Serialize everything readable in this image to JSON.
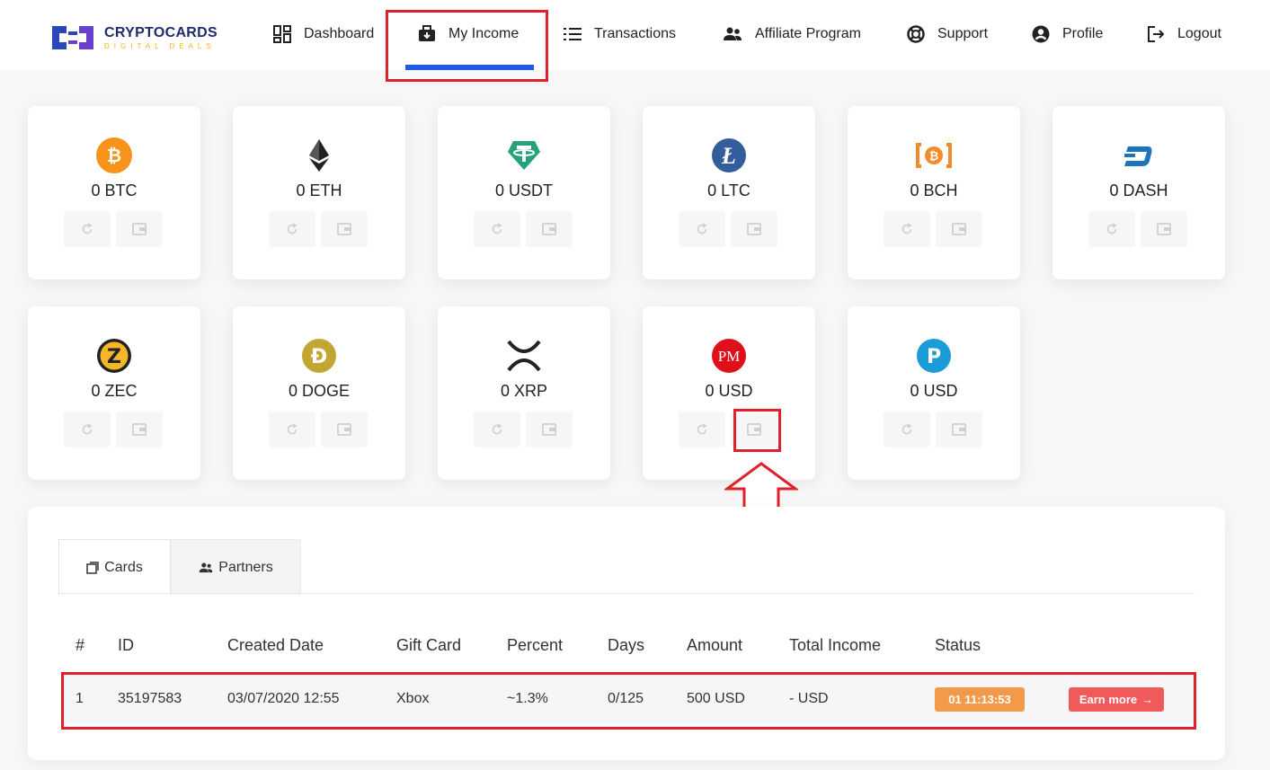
{
  "brand": {
    "name": "CRYPTOCARDS",
    "tagline": "DIGITAL DEALS",
    "colors": {
      "navy": "#1e2b6e",
      "yellow": "#f2b51c",
      "purple": "#6a3fd0"
    }
  },
  "nav": {
    "items": [
      {
        "label": "Dashboard",
        "icon": "dashboard-icon"
      },
      {
        "label": "My Income",
        "icon": "briefcase-icon",
        "active": true
      },
      {
        "label": "Transactions",
        "icon": "list-icon"
      },
      {
        "label": "Affiliate Program",
        "icon": "users-icon"
      },
      {
        "label": "Support",
        "icon": "lifebuoy-icon"
      },
      {
        "label": "Profile",
        "icon": "user-circle-icon"
      },
      {
        "label": "Logout",
        "icon": "logout-icon"
      }
    ],
    "accent": "#1f5ae8"
  },
  "coins": [
    {
      "label": "0 BTC",
      "icon": "bitcoin-icon",
      "color": "#f7931a"
    },
    {
      "label": "0 ETH",
      "icon": "ethereum-icon",
      "color": "#222222"
    },
    {
      "label": "0 USDT",
      "icon": "tether-icon",
      "color": "#26a17b"
    },
    {
      "label": "0 LTC",
      "icon": "litecoin-icon",
      "color": "#345d9d"
    },
    {
      "label": "0 BCH",
      "icon": "bitcoin-cash-icon",
      "color": "#f28c28"
    },
    {
      "label": "0 DASH",
      "icon": "dash-icon",
      "color": "#1c75bc"
    },
    {
      "label": "0 ZEC",
      "icon": "zcash-icon",
      "color": "#f4b728"
    },
    {
      "label": "0 DOGE",
      "icon": "dogecoin-icon",
      "color": "#c2a633"
    },
    {
      "label": "0 XRP",
      "icon": "xrp-icon",
      "color": "#222222"
    },
    {
      "label": "0 USD",
      "icon": "perfect-money-icon",
      "color": "#e0101a",
      "text": "PM"
    },
    {
      "label": "0 USD",
      "icon": "payeer-icon",
      "color": "#1b9bd8",
      "text": "P"
    }
  ],
  "tabs": [
    {
      "label": "Cards",
      "icon": "cards-icon",
      "active": true
    },
    {
      "label": "Partners",
      "icon": "users-icon"
    }
  ],
  "table": {
    "columns": [
      "#",
      "ID",
      "Created Date",
      "Gift Card",
      "Percent",
      "Days",
      "Amount",
      "Total Income",
      "Status"
    ],
    "rows": [
      {
        "num": "1",
        "id": "35197583",
        "created": "03/07/2020 12:55",
        "gift_card": "Xbox",
        "percent": "~1.3%",
        "days": "0/125",
        "amount": "500 USD",
        "total_income": "- USD",
        "status": "01 11:13:53",
        "action": "Earn more",
        "action_arrow": "→"
      }
    ]
  },
  "colors": {
    "highlight": "#e0202b",
    "status": "#f2994a",
    "action": "#f05a5a"
  }
}
